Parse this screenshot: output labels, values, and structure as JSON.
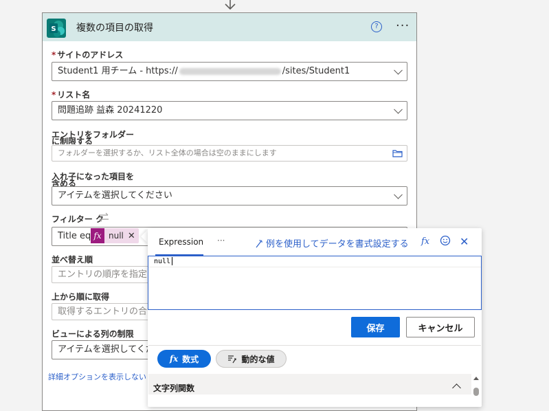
{
  "card": {
    "title": "複数の項目の取得",
    "help_icon": "?",
    "more_icon": "···",
    "logo_letter": "S"
  },
  "fields": {
    "site_label": "サイトのアドレス",
    "site_prefix": "Student1 用チーム - https://",
    "site_suffix": "/sites/Student1",
    "list_label": "リスト名",
    "list_value": "問題追跡 益森 20241220",
    "folder_label_1": "エントリをフォルダー",
    "folder_label_2": "に制限する",
    "folder_placeholder": "フォルダーを選択するか、リスト全体の場合は空のままにします",
    "nested_label_1": "入れ子になった項目を",
    "nested_label_2": "含める",
    "nested_placeholder": "アイテムを選択してください",
    "filter_label": "フィルター ク",
    "filter_text": "Title eq",
    "filter_token": "null",
    "order_label": "並べ替え順",
    "order_placeholder": "エントリの順序を指定",
    "top_label": "上から順に取得",
    "top_placeholder": "取得するエントリの合計",
    "view_label": "ビューによる列の制限",
    "view_placeholder": "アイテムを選択してくだ",
    "advanced_link": "詳細オプションを表示しない"
  },
  "popup": {
    "tab_expression": "Expression",
    "tab_more": "···",
    "example_link": "例を使用してデータを書式設定する",
    "code": "null",
    "save_label": "保存",
    "cancel_label": "キャンセル",
    "pill_fx": "数式",
    "pill_dynamic": "動的な値",
    "section_title": "文字列関数"
  },
  "colors": {
    "accent": "#0f6cda",
    "header_bg": "#d6e9e8",
    "token_bg": "#9c1b7f"
  }
}
